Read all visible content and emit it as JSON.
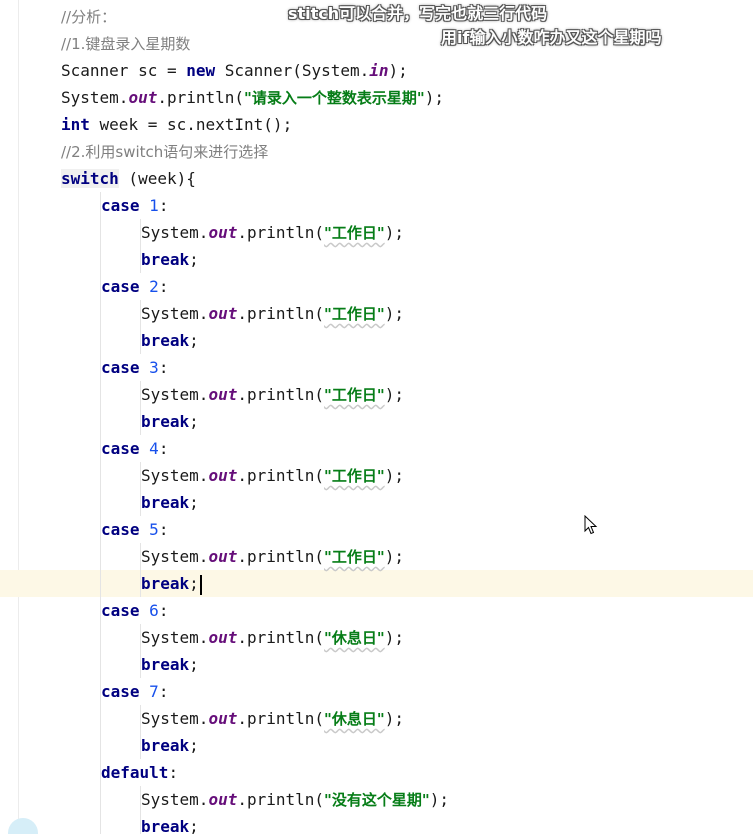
{
  "subtitles": {
    "line1": "stitch可以合并，写完也就三行代码",
    "line2": "用if输入小数咋办又这个星期吗"
  },
  "code": {
    "comment_analysis": "//分析：",
    "comment_step1": "//1.键盘录入星期数",
    "scanner_decl": {
      "type": "Scanner sc = ",
      "kw_new": "new",
      "ctor": " Scanner(System.",
      "field_in": "in",
      "end": ");"
    },
    "prompt_line": {
      "prefix": "System.",
      "field_out": "out",
      "mid": ".println(",
      "str": "\"请录入一个整数表示星期\"",
      "end": ");"
    },
    "week_decl": {
      "kw_int": "int",
      "rest": " week = sc.nextInt();"
    },
    "comment_step2": "//2.利用switch语句来进行选择",
    "switch_line": {
      "kw_switch": "switch",
      "rest": " (week){"
    },
    "kw_case": "case",
    "kw_break": "break",
    "kw_default": "default",
    "println_prefix": "System.",
    "println_field": "out",
    "println_mid": ".println(",
    "println_end": ");",
    "break_end": ";",
    "colon": ":",
    "cases": [
      {
        "num": "1",
        "str": "\"工作日\""
      },
      {
        "num": "2",
        "str": "\"工作日\""
      },
      {
        "num": "3",
        "str": "\"工作日\""
      },
      {
        "num": "4",
        "str": "\"工作日\""
      },
      {
        "num": "5",
        "str": "\"工作日\""
      },
      {
        "num": "6",
        "str": "\"休息日\""
      },
      {
        "num": "7",
        "str": "\"休息日\""
      }
    ],
    "default_str": "\"没有这个星期\""
  },
  "icons": {
    "cursor": "mouse-pointer-icon"
  },
  "colors": {
    "keyword": "#000080",
    "string": "#067d17",
    "comment": "#808080",
    "field": "#660e7a",
    "number": "#1750eb",
    "current_line": "#fdf8e6"
  }
}
